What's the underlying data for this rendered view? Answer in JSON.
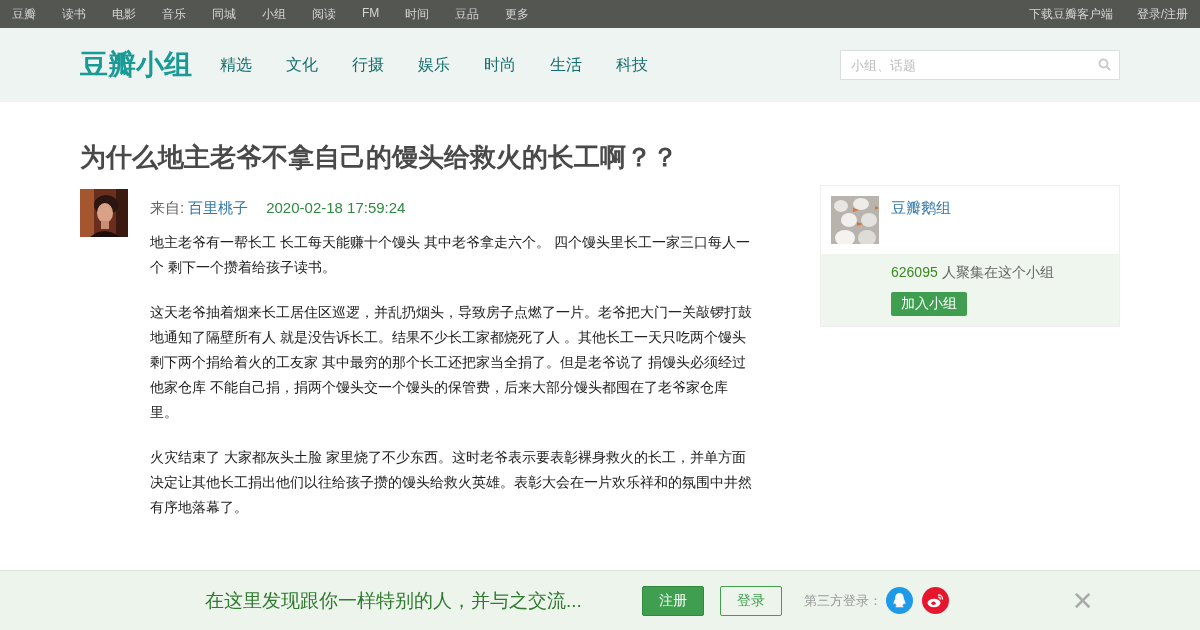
{
  "top_nav": {
    "left": [
      "豆瓣",
      "读书",
      "电影",
      "音乐",
      "同城",
      "小组",
      "阅读",
      "FM",
      "时间",
      "豆品",
      "更多"
    ],
    "right": [
      "下载豆瓣客户端",
      "登录/注册"
    ]
  },
  "header": {
    "logo": "豆瓣小组",
    "nav": [
      "精选",
      "文化",
      "行摄",
      "娱乐",
      "时尚",
      "生活",
      "科技"
    ],
    "search": {
      "placeholder": "小组、话题"
    }
  },
  "post": {
    "title": "为什么地主老爷不拿自己的馒头给救火的长工啊？？",
    "from_label": "来自:",
    "author": "百里桃子",
    "time": "2020-02-18 17:59:24",
    "paragraphs": [
      "地主老爷有一帮长工 长工每天能赚十个馒头 其中老爷拿走六个。 四个馒头里长工一家三口每人一个  剩下一个攒着给孩子读书。",
      "这天老爷抽着烟来长工居住区巡逻，并乱扔烟头，导致房子点燃了一片。老爷把大门一关敲锣打鼓地通知了隔壁所有人 就是没告诉长工。结果不少长工家都烧死了人 。其他长工一天只吃两个馒头剩下两个捐给着火的工友家 其中最穷的那个长工还把家当全捐了。但是老爷说了 捐馒头必须经过他家仓库 不能自己捐，捐两个馒头交一个馒头的保管费，后来大部分馒头都囤在了老爷家仓库里。",
      "火灾结束了 大家都灰头土脸 家里烧了不少东西。这时老爷表示要表彰裸身救火的长工，并单方面决定让其他长工捐出他们以往给孩子攒的馒头给救火英雄。表彰大会在一片欢乐祥和的氛围中井然有序地落幕了。"
    ]
  },
  "group_card": {
    "name": "豆瓣鹅组",
    "members_count": "626095",
    "members_text": "人聚集在这个小组",
    "join_button": "加入小组"
  },
  "bottom_bar": {
    "slogan": "在这里发现跟你一样特别的人，并与之交流...",
    "register_button": "注册",
    "login_button": "登录",
    "third_party_label": "第三方登录：",
    "close": "✕"
  }
}
